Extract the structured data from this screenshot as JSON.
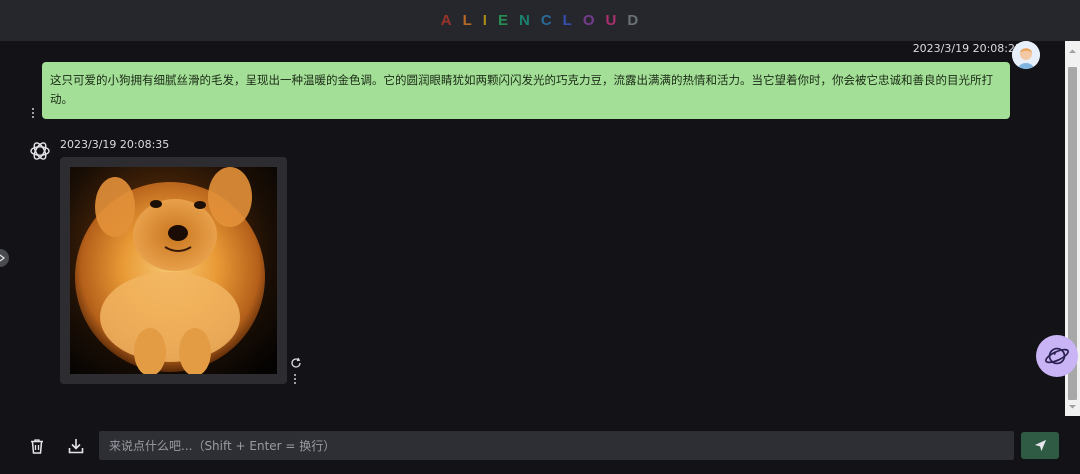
{
  "header": {
    "letters": [
      "A",
      "L",
      "I",
      "E",
      "N",
      "C",
      "L",
      "O",
      "U",
      "D"
    ],
    "letter_colors": [
      "#c0392b",
      "#e67e22",
      "#d4ac0d",
      "#27ae60",
      "#16a085",
      "#2980b9",
      "#3b5bdb",
      "#8e44ad",
      "#d63384",
      "#7f8c8d"
    ]
  },
  "conversation": {
    "user_message": {
      "timestamp": "2023/3/19 20:08:25",
      "text": "这只可爱的小狗拥有细腻丝滑的毛发，呈现出一种温暖的金色调。它的圆润眼睛犹如两颗闪闪发光的巧克力豆，流露出满满的热情和活力。当它望着你时，你会被它忠诚和善良的目光所打动。"
    },
    "bot_message": {
      "timestamp": "2023/3/19 20:08:35"
    }
  },
  "input": {
    "placeholder": "来说点什么吧...（Shift + Enter = 换行）",
    "value": ""
  },
  "colors": {
    "user_bubble": "#a3df96",
    "send_button": "#2f5b45",
    "planet_button": "#c9b4f6"
  }
}
